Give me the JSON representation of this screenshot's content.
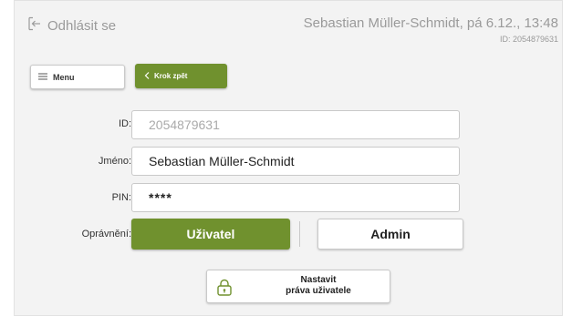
{
  "header": {
    "logout_label": "Odhlásit se",
    "user_info": "Sebastian Müller-Schmidt, pá 6.12., 13:48",
    "user_id_label": "ID: 2054879631"
  },
  "toolbar": {
    "menu_label": "Menu",
    "back_label": "Krok zpět"
  },
  "form": {
    "id_label": "ID:",
    "id_value": "2054879631",
    "name_label": "Jméno:",
    "name_value": "Sebastian Müller-Schmidt",
    "pin_label": "PIN:",
    "pin_value": "****",
    "permissions_label": "Oprávnění:",
    "permission_user": "Uživatel",
    "permission_admin": "Admin",
    "selected_permission": "Uživatel"
  },
  "rights_button": {
    "line1": "Nastavit",
    "line2": "práva uživatele"
  },
  "colors": {
    "accent": "#70912e",
    "muted_text": "#9a9a9a",
    "panel_bg": "#f3f3f3"
  },
  "icons": {
    "logout": "logout-arrow-icon",
    "menu": "hamburger-icon",
    "back": "chevron-left-icon",
    "rights": "lock-icon"
  }
}
